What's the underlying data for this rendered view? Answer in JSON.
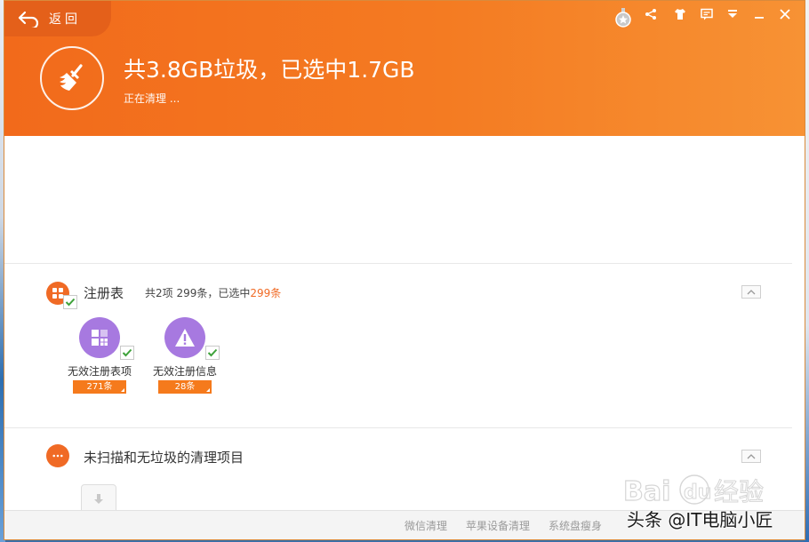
{
  "window": {
    "back_label": "返回",
    "headline": "共3.8GB垃圾，已选中1.7GB",
    "status": "正在清理 ..."
  },
  "titlebar": {
    "icons": [
      "medal-icon",
      "share-icon",
      "skin-icon",
      "feedback-icon",
      "menu-icon",
      "minimize-icon",
      "close-icon"
    ]
  },
  "sections": {
    "registry": {
      "title": "注册表",
      "count_prefix": "共2项 299条，已选中",
      "count_selected": "299条",
      "items": [
        {
          "label": "无效注册表项",
          "badge": "271条",
          "icon": "registry-grid-icon"
        },
        {
          "label": "无效注册信息",
          "badge": "28条",
          "icon": "warning-icon"
        }
      ]
    },
    "unscanned": {
      "title": "未扫描和无垃圾的清理项目"
    }
  },
  "footer": {
    "links": [
      "微信清理",
      "苹果设备清理",
      "系统盘瘦身"
    ]
  },
  "watermarks": {
    "baidu": "Baidu 经验",
    "toutiao": "头条 @IT电脑小匠"
  },
  "colors": {
    "header_orange": "#f47b22",
    "accent": "#f06a25",
    "item_purple": "#a779e0",
    "check_green": "#3ea23a"
  }
}
